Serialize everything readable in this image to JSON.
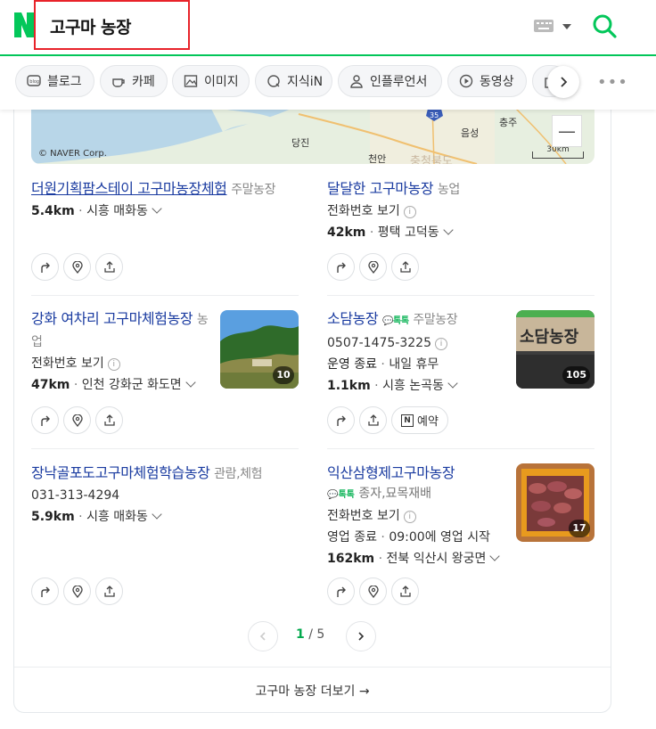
{
  "header": {
    "logo": "N",
    "query": "고구마 농장",
    "keyboard_icon": "keyboard-icon",
    "search_icon": "search-icon",
    "accent_color": "#03c75a"
  },
  "tabs": [
    {
      "label": "블로그",
      "icon": "blog-icon"
    },
    {
      "label": "카페",
      "icon": "cafe-icon"
    },
    {
      "label": "이미지",
      "icon": "image-icon"
    },
    {
      "label": "지식iN",
      "icon": "kin-icon"
    },
    {
      "label": "인플루언서",
      "icon": "person-icon"
    },
    {
      "label": "동영상",
      "icon": "play-icon"
    }
  ],
  "map": {
    "copyright": "© NAVER Corp.",
    "scale": "30km",
    "cities": [
      "당진",
      "천안",
      "음성",
      "충주",
      "충청북도"
    ],
    "road": "35"
  },
  "results": [
    {
      "name": "더원기획팜스테이 고구마농장체험",
      "category": "주말농장",
      "distance": "5.4km",
      "location": "시흥 매화동"
    },
    {
      "name": "달달한 고구마농장",
      "category": "농업",
      "phone": "전화번호 보기",
      "distance": "42km",
      "location": "평택 고덕동"
    },
    {
      "name": "강화 여차리 고구마체험농장",
      "category": "농업",
      "phone": "전화번호 보기",
      "distance": "47km",
      "location": "인천 강화군 화도면",
      "photo_count": "10"
    },
    {
      "name": "소담농장",
      "talk": "톡톡",
      "category": "주말농장",
      "phone": "0507-1475-3225",
      "status": "운영 종료",
      "status_detail": "내일 휴무",
      "distance": "1.1km",
      "location": "시흥 논곡동",
      "photo_count": "105",
      "reserve": "예약"
    },
    {
      "name": "장낙골포도고구마체험학습농장",
      "category": "관람,체험",
      "phone": "031-313-4294",
      "distance": "5.9km",
      "location": "시흥 매화동"
    },
    {
      "name": "익산삼형제고구마농장",
      "talk": "톡톡",
      "category": "종자,묘목재배",
      "phone": "전화번호 보기",
      "status": "영업 종료",
      "status_detail": "09:00에 영업 시작",
      "distance": "162km",
      "location": "전북 익산시 왕궁면",
      "photo_count": "17"
    }
  ],
  "pagination": {
    "current": "1",
    "separator": "/",
    "total": "5"
  },
  "more_link": "고구마 농장 더보기 →"
}
